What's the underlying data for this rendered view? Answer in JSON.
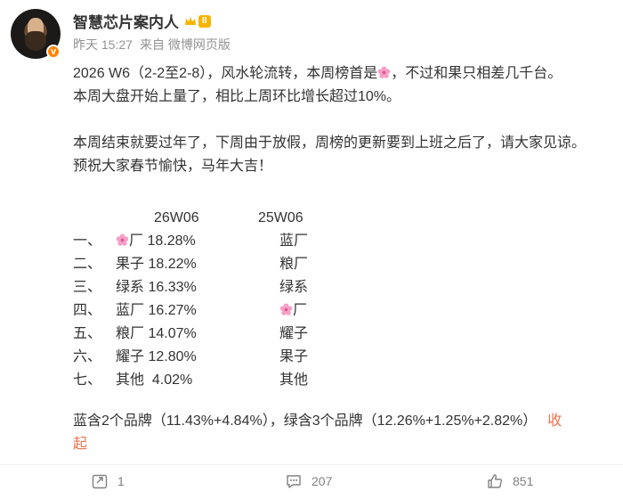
{
  "author": {
    "name": "智慧芯片案内人",
    "level_badge": "II",
    "verified_badge": "v"
  },
  "meta": {
    "time": "昨天 15:27",
    "source_prefix": "来自",
    "source": "微博网页版"
  },
  "post": {
    "para1_a": "2026 W6（2-2至2-8），风水轮流转，本周榜首是",
    "para1_b": "，不过和果只相差几千台。",
    "para2": "本周大盘开始上量了，相比上周环比增长超过10%。",
    "para3": "本周结束就要过年了，下周由于放假，周榜的更新要到上班之后了，请大家见谅。",
    "para4": "预祝大家春节愉快，马年大吉！",
    "ranking": {
      "header_a": "26W06",
      "header_b": "25W06",
      "rows": [
        {
          "rank": "一、",
          "a": "厂 18.28%",
          "b": "蓝厂"
        },
        {
          "rank": "二、",
          "a": "果子 18.22%",
          "b": "粮厂"
        },
        {
          "rank": "三、",
          "a": "绿系 16.33%",
          "b": "绿系"
        },
        {
          "rank": "四、",
          "a": "蓝厂 16.27%",
          "b": "厂"
        },
        {
          "rank": "五、",
          "a": "粮厂 14.07%",
          "b": "耀子"
        },
        {
          "rank": "六、",
          "a": "耀子 12.80%",
          "b": "果子"
        },
        {
          "rank": "七、",
          "a": "其他  4.02%",
          "b": "其他"
        }
      ]
    },
    "summary": "蓝含2个品牌（11.43%+4.84%），绿含3个品牌（12.26%+1.25%+2.82%）",
    "collapse_1": "收",
    "collapse_2": "起"
  },
  "actions": {
    "repost": "1",
    "comment": "207",
    "like": "851"
  },
  "colors": {
    "accent": "#eb7350",
    "flower": "#f5a0c8",
    "badge": "#ff8200",
    "level": "#f5b400"
  }
}
